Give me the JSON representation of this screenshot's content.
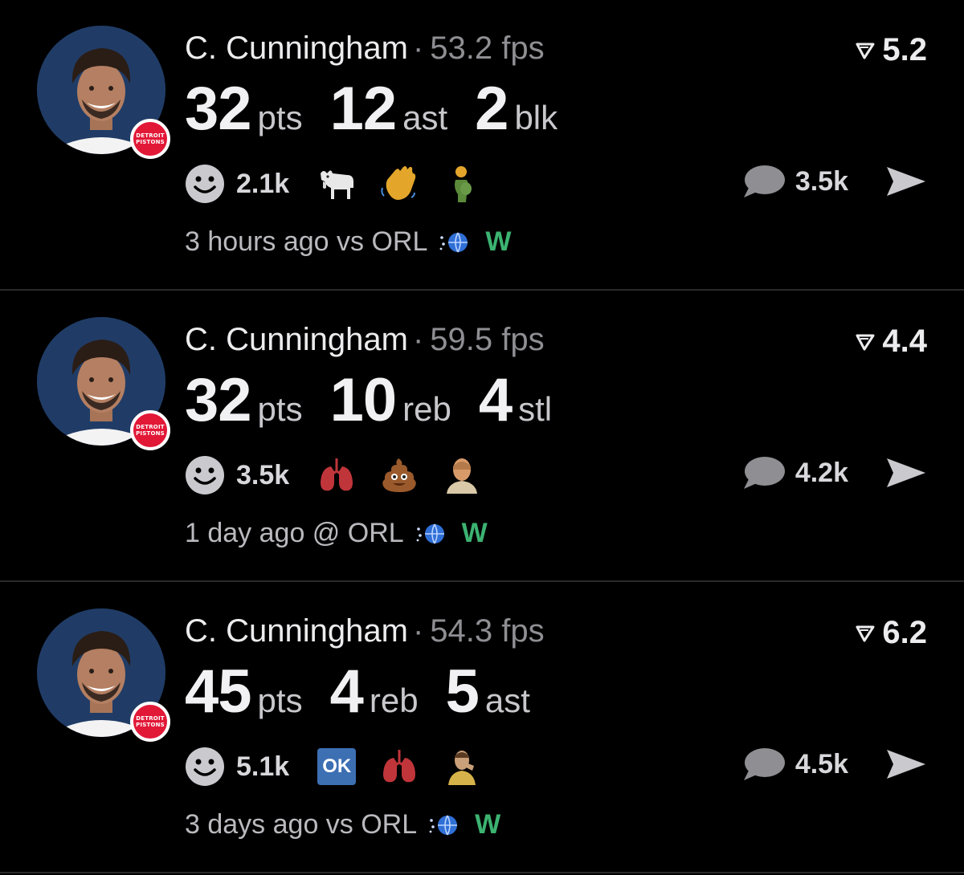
{
  "feed": {
    "posts": [
      {
        "player": "C. Cunningham",
        "fps": "53.2 fps",
        "rating": "5.2",
        "team_badge": "DETROIT PISTONS",
        "stats": [
          {
            "value": "32",
            "unit": "pts"
          },
          {
            "value": "12",
            "unit": "ast"
          },
          {
            "value": "2",
            "unit": "blk"
          }
        ],
        "reaction_count": "2.1k",
        "reaction_icons": [
          "goat-emoji",
          "waving-hand-emoji",
          "pregnant-person-emoji"
        ],
        "comment_count": "3.5k",
        "time": "3 hours ago vs ORL",
        "result": "W"
      },
      {
        "player": "C. Cunningham",
        "fps": "59.5 fps",
        "rating": "4.4",
        "team_badge": "DETROIT PISTONS",
        "stats": [
          {
            "value": "32",
            "unit": "pts"
          },
          {
            "value": "10",
            "unit": "reb"
          },
          {
            "value": "4",
            "unit": "stl"
          }
        ],
        "reaction_count": "3.5k",
        "reaction_icons": [
          "lungs-emoji",
          "poop-emoji",
          "person-sticker"
        ],
        "comment_count": "4.2k",
        "time": "1 day ago @ ORL",
        "result": "W"
      },
      {
        "player": "C. Cunningham",
        "fps": "54.3 fps",
        "rating": "6.2",
        "team_badge": "DETROIT PISTONS",
        "stats": [
          {
            "value": "45",
            "unit": "pts"
          },
          {
            "value": "4",
            "unit": "reb"
          },
          {
            "value": "5",
            "unit": "ast"
          }
        ],
        "reaction_count": "5.1k",
        "reaction_icons": [
          "ok-button",
          "lungs-emoji",
          "player-sticker"
        ],
        "ok_label": "OK",
        "comment_count": "4.5k",
        "time": "3 days ago vs ORL",
        "result": "W"
      }
    ]
  },
  "colors": {
    "background": "#000000",
    "win": "#3cb371",
    "muted": "#8e8e93",
    "team": "#e21837"
  }
}
